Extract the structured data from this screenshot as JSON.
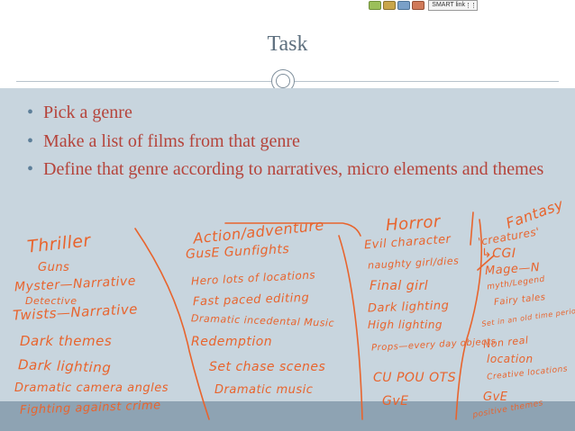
{
  "toolbar": {
    "smart_link_label": "SMART link"
  },
  "slide": {
    "title": "Task",
    "bullets": [
      "Pick a genre",
      "Make a list of films from that genre",
      "Define that genre according to narratives, micro elements and themes"
    ]
  },
  "annotations": {
    "thriller": {
      "heading": "Thriller",
      "items": [
        "Guns",
        "Myster—Narrative",
        "Detective",
        "Twists—Narrative",
        "Dark themes",
        "Dark lighting",
        "Dramatic camera angles",
        "Fighting against crime"
      ]
    },
    "action": {
      "heading": "Action/adventure",
      "items": [
        "GusE Gunfights",
        "Hero lots of locations",
        "Fast paced editing",
        "Dramatic incedental Music",
        "Redemption",
        "Set chase scenes",
        "Dramatic music"
      ]
    },
    "horror": {
      "heading": "Horror",
      "items": [
        "Evil character",
        "naughty girl/dies",
        "Final girl",
        "Dark lighting",
        "High lighting",
        "Props—every day objects",
        "CU POU OTS",
        "GvE"
      ]
    },
    "fantasy": {
      "heading": "Fantasy",
      "items": [
        "'creatures'",
        "↳CGI",
        "Mage—N",
        "myth/Legend",
        "Fairy tales",
        "Set in an old time period",
        "Non real",
        "location",
        "Creative locations",
        "GvE",
        "positive themes"
      ]
    }
  },
  "colors": {
    "ink": "#e8642d",
    "bullet_text": "#b5443b",
    "panel": "#c8d5de",
    "band": "#8ea3b3",
    "title": "#5d6f7e"
  }
}
